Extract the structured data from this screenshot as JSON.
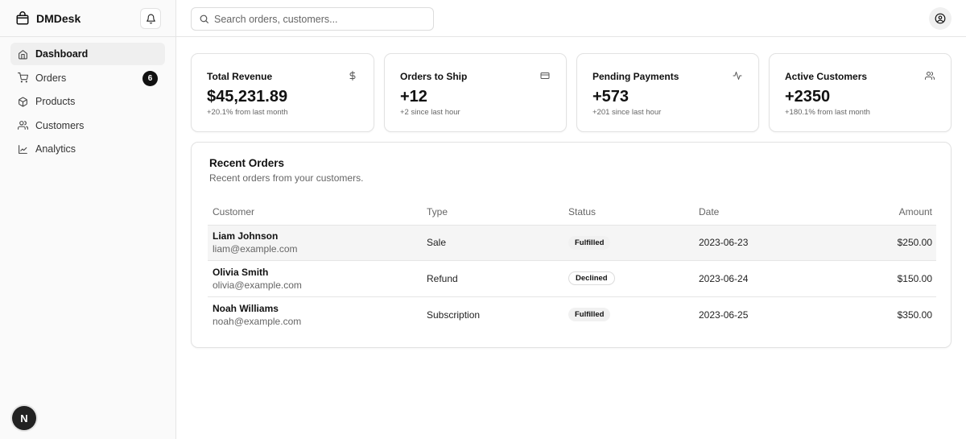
{
  "app": {
    "name": "DMDesk"
  },
  "nav": [
    {
      "label": "Dashboard",
      "icon": "home-icon",
      "active": true
    },
    {
      "label": "Orders",
      "icon": "cart-icon",
      "badge": "6"
    },
    {
      "label": "Products",
      "icon": "package-icon"
    },
    {
      "label": "Customers",
      "icon": "users-icon"
    },
    {
      "label": "Analytics",
      "icon": "line-chart-icon"
    }
  ],
  "user_initial": "N",
  "search": {
    "placeholder": "Search orders, customers..."
  },
  "cards": [
    {
      "title": "Total Revenue",
      "icon": "dollar-icon",
      "value": "$45,231.89",
      "sub": "+20.1% from last month"
    },
    {
      "title": "Orders to Ship",
      "icon": "credit-card-icon",
      "value": "+12",
      "sub": "+2 since last hour"
    },
    {
      "title": "Pending Payments",
      "icon": "activity-icon",
      "value": "+573",
      "sub": "+201 since last hour"
    },
    {
      "title": "Active Customers",
      "icon": "users-icon",
      "value": "+2350",
      "sub": "+180.1% from last month"
    }
  ],
  "recent_orders": {
    "title": "Recent Orders",
    "description": "Recent orders from your customers.",
    "columns": [
      "Customer",
      "Type",
      "Status",
      "Date",
      "Amount"
    ],
    "rows": [
      {
        "name": "Liam Johnson",
        "email": "liam@example.com",
        "type": "Sale",
        "status": "Fulfilled",
        "date": "2023-06-23",
        "amount": "$250.00"
      },
      {
        "name": "Olivia Smith",
        "email": "olivia@example.com",
        "type": "Refund",
        "status": "Declined",
        "date": "2023-06-24",
        "amount": "$150.00"
      },
      {
        "name": "Noah Williams",
        "email": "noah@example.com",
        "type": "Subscription",
        "status": "Fulfilled",
        "date": "2023-06-25",
        "amount": "$350.00"
      }
    ]
  }
}
